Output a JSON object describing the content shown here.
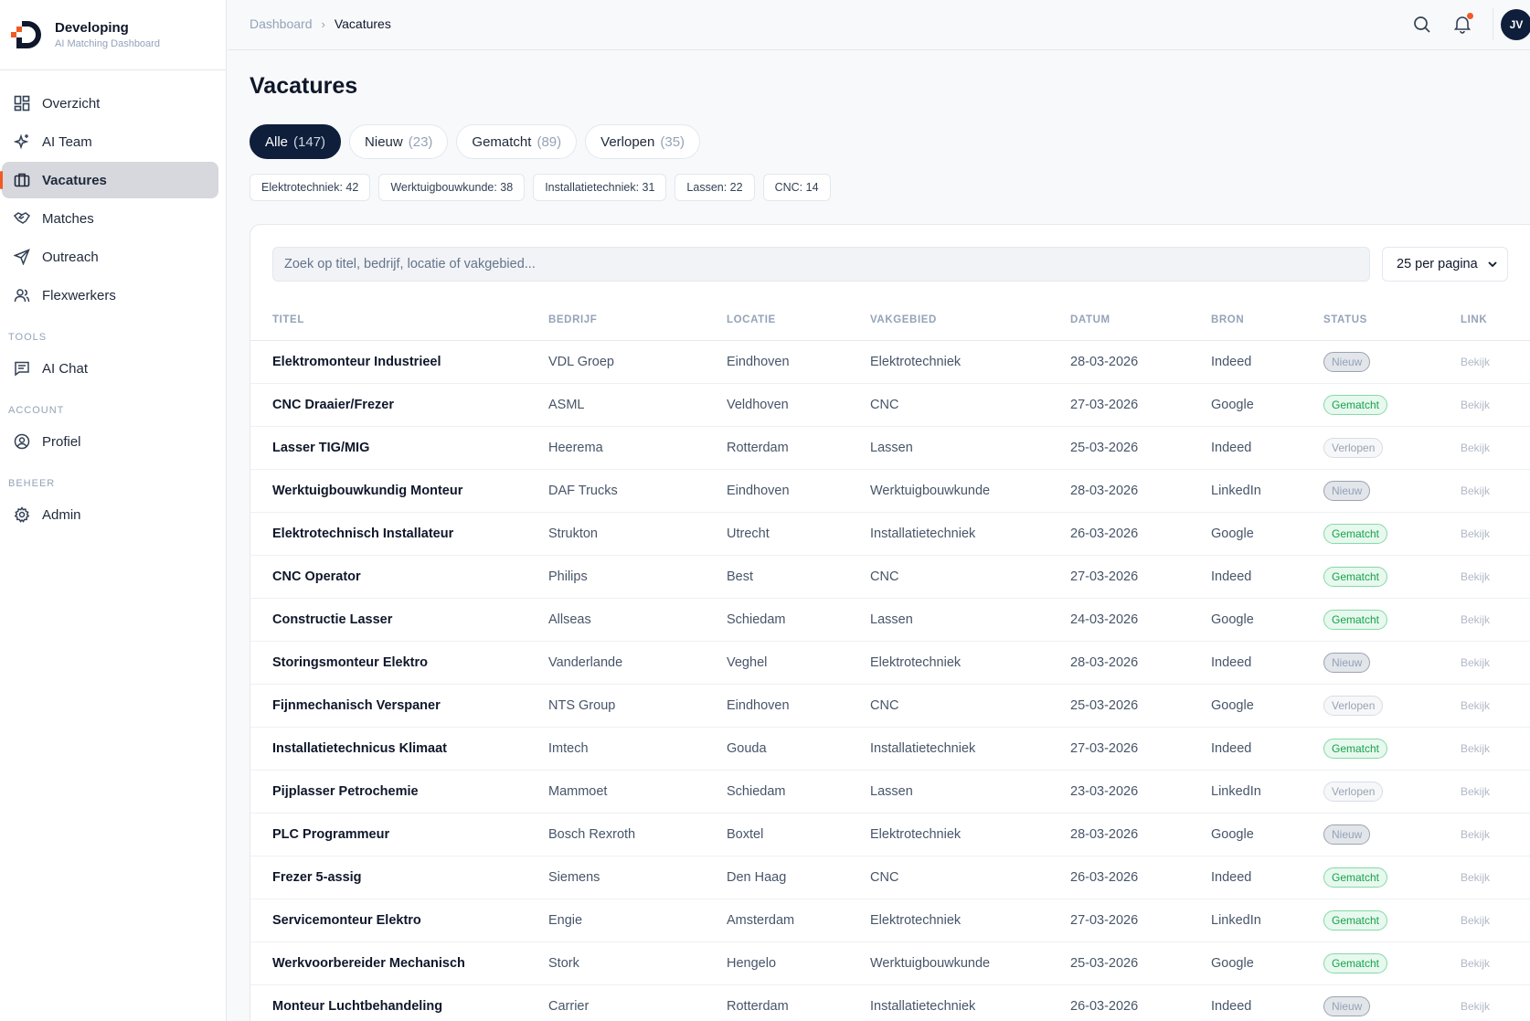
{
  "brand": {
    "name": "Developing",
    "subtitle": "AI Matching Dashboard"
  },
  "nav": {
    "items": [
      {
        "label": "Overzicht",
        "icon": "grid-icon"
      },
      {
        "label": "AI Team",
        "icon": "sparkles-icon"
      },
      {
        "label": "Vacatures",
        "icon": "briefcase-icon",
        "active": true
      },
      {
        "label": "Matches",
        "icon": "handshake-icon"
      },
      {
        "label": "Outreach",
        "icon": "send-icon"
      },
      {
        "label": "Flexwerkers",
        "icon": "users-icon"
      }
    ],
    "tools_label": "TOOLS",
    "tools": [
      {
        "label": "AI Chat",
        "icon": "chat-icon"
      }
    ],
    "account_label": "ACCOUNT",
    "account": [
      {
        "label": "Profiel",
        "icon": "user-circle-icon"
      }
    ],
    "beheer_label": "BEHEER",
    "beheer": [
      {
        "label": "Admin",
        "icon": "gear-icon"
      }
    ]
  },
  "header": {
    "breadcrumb": [
      "Dashboard",
      "Vacatures"
    ],
    "avatar_initials": "JV"
  },
  "page": {
    "title": "Vacatures"
  },
  "tabs": [
    {
      "label": "Alle",
      "count": "(147)",
      "active": true
    },
    {
      "label": "Nieuw",
      "count": "(23)"
    },
    {
      "label": "Gematcht",
      "count": "(89)"
    },
    {
      "label": "Verlopen",
      "count": "(35)"
    }
  ],
  "chips": [
    "Elektrotechniek: 42",
    "Werktuigbouwkunde: 38",
    "Installatietechniek: 31",
    "Lassen: 22",
    "CNC: 14"
  ],
  "search": {
    "placeholder": "Zoek op titel, bedrijf, locatie of vakgebied...",
    "value": ""
  },
  "per_page": "25 per pagina",
  "table": {
    "headers": [
      "TITEL",
      "BEDRIJF",
      "LOCATIE",
      "VAKGEBIED",
      "DATUM",
      "BRON",
      "STATUS",
      "LINK"
    ],
    "link_label": "Bekijk",
    "rows": [
      {
        "titel": "Elektromonteur Industrieel",
        "bedrijf": "VDL Groep",
        "locatie": "Eindhoven",
        "vakgebied": "Elektrotechniek",
        "datum": "28-03-2026",
        "bron": "Indeed",
        "status": "Nieuw"
      },
      {
        "titel": "CNC Draaier/Frezer",
        "bedrijf": "ASML",
        "locatie": "Veldhoven",
        "vakgebied": "CNC",
        "datum": "27-03-2026",
        "bron": "Google",
        "status": "Gematcht"
      },
      {
        "titel": "Lasser TIG/MIG",
        "bedrijf": "Heerema",
        "locatie": "Rotterdam",
        "vakgebied": "Lassen",
        "datum": "25-03-2026",
        "bron": "Indeed",
        "status": "Verlopen"
      },
      {
        "titel": "Werktuigbouwkundig Monteur",
        "bedrijf": "DAF Trucks",
        "locatie": "Eindhoven",
        "vakgebied": "Werktuigbouwkunde",
        "datum": "28-03-2026",
        "bron": "LinkedIn",
        "status": "Nieuw"
      },
      {
        "titel": "Elektrotechnisch Installateur",
        "bedrijf": "Strukton",
        "locatie": "Utrecht",
        "vakgebied": "Installatietechniek",
        "datum": "26-03-2026",
        "bron": "Google",
        "status": "Gematcht"
      },
      {
        "titel": "CNC Operator",
        "bedrijf": "Philips",
        "locatie": "Best",
        "vakgebied": "CNC",
        "datum": "27-03-2026",
        "bron": "Indeed",
        "status": "Gematcht"
      },
      {
        "titel": "Constructie Lasser",
        "bedrijf": "Allseas",
        "locatie": "Schiedam",
        "vakgebied": "Lassen",
        "datum": "24-03-2026",
        "bron": "Google",
        "status": "Gematcht"
      },
      {
        "titel": "Storingsmonteur Elektro",
        "bedrijf": "Vanderlande",
        "locatie": "Veghel",
        "vakgebied": "Elektrotechniek",
        "datum": "28-03-2026",
        "bron": "Indeed",
        "status": "Nieuw"
      },
      {
        "titel": "Fijnmechanisch Verspaner",
        "bedrijf": "NTS Group",
        "locatie": "Eindhoven",
        "vakgebied": "CNC",
        "datum": "25-03-2026",
        "bron": "Google",
        "status": "Verlopen"
      },
      {
        "titel": "Installatietechnicus Klimaat",
        "bedrijf": "Imtech",
        "locatie": "Gouda",
        "vakgebied": "Installatietechniek",
        "datum": "27-03-2026",
        "bron": "Indeed",
        "status": "Gematcht"
      },
      {
        "titel": "Pijplasser Petrochemie",
        "bedrijf": "Mammoet",
        "locatie": "Schiedam",
        "vakgebied": "Lassen",
        "datum": "23-03-2026",
        "bron": "LinkedIn",
        "status": "Verlopen"
      },
      {
        "titel": "PLC Programmeur",
        "bedrijf": "Bosch Rexroth",
        "locatie": "Boxtel",
        "vakgebied": "Elektrotechniek",
        "datum": "28-03-2026",
        "bron": "Google",
        "status": "Nieuw"
      },
      {
        "titel": "Frezer 5-assig",
        "bedrijf": "Siemens",
        "locatie": "Den Haag",
        "vakgebied": "CNC",
        "datum": "26-03-2026",
        "bron": "Indeed",
        "status": "Gematcht"
      },
      {
        "titel": "Servicemonteur Elektro",
        "bedrijf": "Engie",
        "locatie": "Amsterdam",
        "vakgebied": "Elektrotechniek",
        "datum": "27-03-2026",
        "bron": "LinkedIn",
        "status": "Gematcht"
      },
      {
        "titel": "Werkvoorbereider Mechanisch",
        "bedrijf": "Stork",
        "locatie": "Hengelo",
        "vakgebied": "Werktuigbouwkunde",
        "datum": "25-03-2026",
        "bron": "Google",
        "status": "Gematcht"
      },
      {
        "titel": "Monteur Luchtbehandeling",
        "bedrijf": "Carrier",
        "locatie": "Rotterdam",
        "vakgebied": "Installatietechniek",
        "datum": "26-03-2026",
        "bron": "Indeed",
        "status": "Nieuw"
      }
    ]
  },
  "colors": {
    "accent": "#f15a24",
    "navy": "#0f1e3a",
    "gematcht": "#16a34a"
  }
}
